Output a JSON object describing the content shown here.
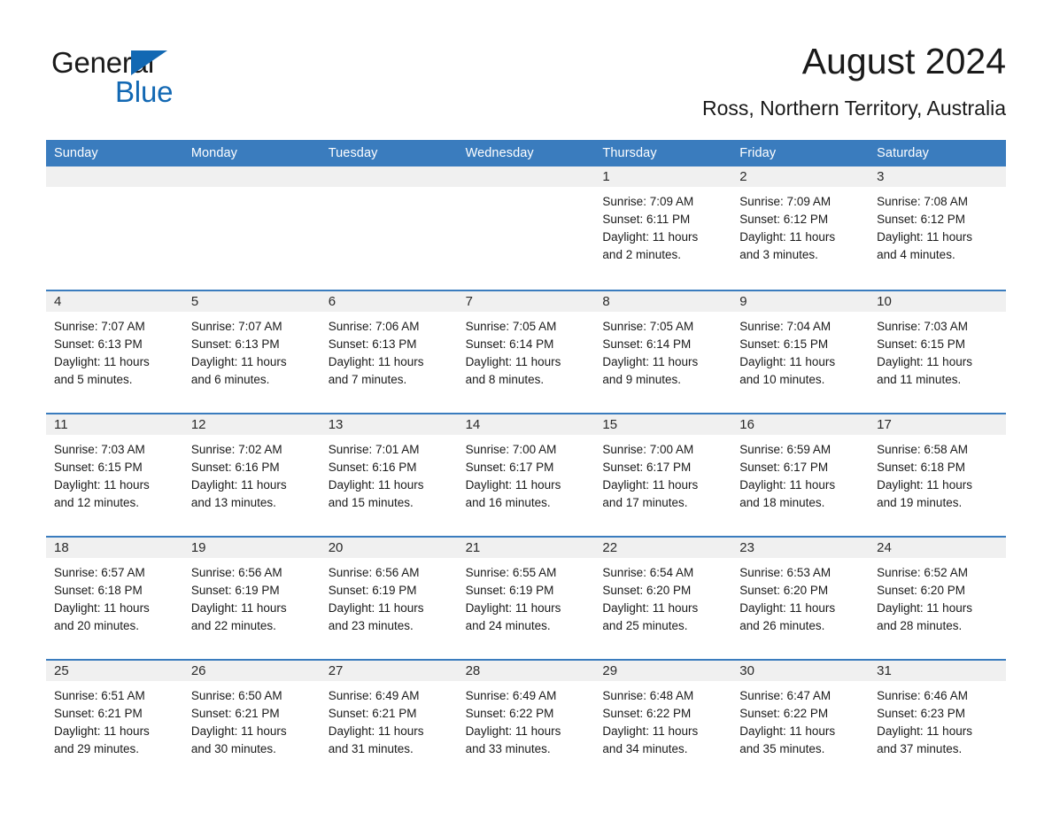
{
  "brand": {
    "name_part1": "General",
    "name_part2": "Blue",
    "accent_color": "#1268b3",
    "triangle_icon": "triangle-icon"
  },
  "header": {
    "month_title": "August 2024",
    "location": "Ross, Northern Territory, Australia"
  },
  "theme": {
    "header_blue": "#3a7cbe",
    "daynum_band": "#f0f0f0",
    "text": "#1a1a1a"
  },
  "weekdays": [
    "Sunday",
    "Monday",
    "Tuesday",
    "Wednesday",
    "Thursday",
    "Friday",
    "Saturday"
  ],
  "weeks": [
    [
      {
        "day": "",
        "lines": []
      },
      {
        "day": "",
        "lines": []
      },
      {
        "day": "",
        "lines": []
      },
      {
        "day": "",
        "lines": []
      },
      {
        "day": "1",
        "lines": [
          "Sunrise: 7:09 AM",
          "Sunset: 6:11 PM",
          "Daylight: 11 hours",
          "and 2 minutes."
        ]
      },
      {
        "day": "2",
        "lines": [
          "Sunrise: 7:09 AM",
          "Sunset: 6:12 PM",
          "Daylight: 11 hours",
          "and 3 minutes."
        ]
      },
      {
        "day": "3",
        "lines": [
          "Sunrise: 7:08 AM",
          "Sunset: 6:12 PM",
          "Daylight: 11 hours",
          "and 4 minutes."
        ]
      }
    ],
    [
      {
        "day": "4",
        "lines": [
          "Sunrise: 7:07 AM",
          "Sunset: 6:13 PM",
          "Daylight: 11 hours",
          "and 5 minutes."
        ]
      },
      {
        "day": "5",
        "lines": [
          "Sunrise: 7:07 AM",
          "Sunset: 6:13 PM",
          "Daylight: 11 hours",
          "and 6 minutes."
        ]
      },
      {
        "day": "6",
        "lines": [
          "Sunrise: 7:06 AM",
          "Sunset: 6:13 PM",
          "Daylight: 11 hours",
          "and 7 minutes."
        ]
      },
      {
        "day": "7",
        "lines": [
          "Sunrise: 7:05 AM",
          "Sunset: 6:14 PM",
          "Daylight: 11 hours",
          "and 8 minutes."
        ]
      },
      {
        "day": "8",
        "lines": [
          "Sunrise: 7:05 AM",
          "Sunset: 6:14 PM",
          "Daylight: 11 hours",
          "and 9 minutes."
        ]
      },
      {
        "day": "9",
        "lines": [
          "Sunrise: 7:04 AM",
          "Sunset: 6:15 PM",
          "Daylight: 11 hours",
          "and 10 minutes."
        ]
      },
      {
        "day": "10",
        "lines": [
          "Sunrise: 7:03 AM",
          "Sunset: 6:15 PM",
          "Daylight: 11 hours",
          "and 11 minutes."
        ]
      }
    ],
    [
      {
        "day": "11",
        "lines": [
          "Sunrise: 7:03 AM",
          "Sunset: 6:15 PM",
          "Daylight: 11 hours",
          "and 12 minutes."
        ]
      },
      {
        "day": "12",
        "lines": [
          "Sunrise: 7:02 AM",
          "Sunset: 6:16 PM",
          "Daylight: 11 hours",
          "and 13 minutes."
        ]
      },
      {
        "day": "13",
        "lines": [
          "Sunrise: 7:01 AM",
          "Sunset: 6:16 PM",
          "Daylight: 11 hours",
          "and 15 minutes."
        ]
      },
      {
        "day": "14",
        "lines": [
          "Sunrise: 7:00 AM",
          "Sunset: 6:17 PM",
          "Daylight: 11 hours",
          "and 16 minutes."
        ]
      },
      {
        "day": "15",
        "lines": [
          "Sunrise: 7:00 AM",
          "Sunset: 6:17 PM",
          "Daylight: 11 hours",
          "and 17 minutes."
        ]
      },
      {
        "day": "16",
        "lines": [
          "Sunrise: 6:59 AM",
          "Sunset: 6:17 PM",
          "Daylight: 11 hours",
          "and 18 minutes."
        ]
      },
      {
        "day": "17",
        "lines": [
          "Sunrise: 6:58 AM",
          "Sunset: 6:18 PM",
          "Daylight: 11 hours",
          "and 19 minutes."
        ]
      }
    ],
    [
      {
        "day": "18",
        "lines": [
          "Sunrise: 6:57 AM",
          "Sunset: 6:18 PM",
          "Daylight: 11 hours",
          "and 20 minutes."
        ]
      },
      {
        "day": "19",
        "lines": [
          "Sunrise: 6:56 AM",
          "Sunset: 6:19 PM",
          "Daylight: 11 hours",
          "and 22 minutes."
        ]
      },
      {
        "day": "20",
        "lines": [
          "Sunrise: 6:56 AM",
          "Sunset: 6:19 PM",
          "Daylight: 11 hours",
          "and 23 minutes."
        ]
      },
      {
        "day": "21",
        "lines": [
          "Sunrise: 6:55 AM",
          "Sunset: 6:19 PM",
          "Daylight: 11 hours",
          "and 24 minutes."
        ]
      },
      {
        "day": "22",
        "lines": [
          "Sunrise: 6:54 AM",
          "Sunset: 6:20 PM",
          "Daylight: 11 hours",
          "and 25 minutes."
        ]
      },
      {
        "day": "23",
        "lines": [
          "Sunrise: 6:53 AM",
          "Sunset: 6:20 PM",
          "Daylight: 11 hours",
          "and 26 minutes."
        ]
      },
      {
        "day": "24",
        "lines": [
          "Sunrise: 6:52 AM",
          "Sunset: 6:20 PM",
          "Daylight: 11 hours",
          "and 28 minutes."
        ]
      }
    ],
    [
      {
        "day": "25",
        "lines": [
          "Sunrise: 6:51 AM",
          "Sunset: 6:21 PM",
          "Daylight: 11 hours",
          "and 29 minutes."
        ]
      },
      {
        "day": "26",
        "lines": [
          "Sunrise: 6:50 AM",
          "Sunset: 6:21 PM",
          "Daylight: 11 hours",
          "and 30 minutes."
        ]
      },
      {
        "day": "27",
        "lines": [
          "Sunrise: 6:49 AM",
          "Sunset: 6:21 PM",
          "Daylight: 11 hours",
          "and 31 minutes."
        ]
      },
      {
        "day": "28",
        "lines": [
          "Sunrise: 6:49 AM",
          "Sunset: 6:22 PM",
          "Daylight: 11 hours",
          "and 33 minutes."
        ]
      },
      {
        "day": "29",
        "lines": [
          "Sunrise: 6:48 AM",
          "Sunset: 6:22 PM",
          "Daylight: 11 hours",
          "and 34 minutes."
        ]
      },
      {
        "day": "30",
        "lines": [
          "Sunrise: 6:47 AM",
          "Sunset: 6:22 PM",
          "Daylight: 11 hours",
          "and 35 minutes."
        ]
      },
      {
        "day": "31",
        "lines": [
          "Sunrise: 6:46 AM",
          "Sunset: 6:23 PM",
          "Daylight: 11 hours",
          "and 37 minutes."
        ]
      }
    ]
  ]
}
